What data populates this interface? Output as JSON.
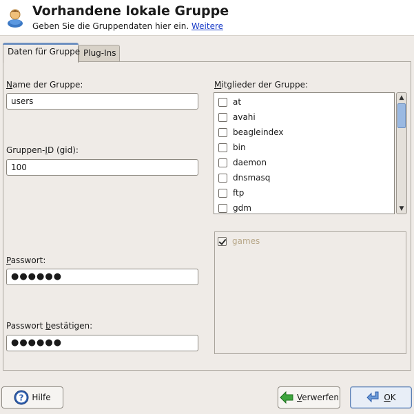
{
  "header": {
    "title": "Vorhandene lokale Gruppe",
    "subtitle": "Geben Sie die Gruppendaten hier ein.",
    "more_link": "Weitere",
    "icon": "group-user-icon"
  },
  "tabs": [
    {
      "label": "Daten für Gruppe",
      "active": true
    },
    {
      "label": "Plug-Ins",
      "active": false
    }
  ],
  "form": {
    "group_name": {
      "label_mn": "N",
      "label_rest": "ame der Gruppe:",
      "value": "users"
    },
    "group_id": {
      "label_pre": "Gruppen-",
      "label_mn": "I",
      "label_rest": "D (gid):",
      "value": "100"
    },
    "password": {
      "label_mn": "P",
      "label_rest": "asswort:",
      "value": "●●●●●●"
    },
    "password_confirm": {
      "label_pre": "Passwort ",
      "label_mn": "b",
      "label_rest": "estätigen:",
      "value": "●●●●●●"
    }
  },
  "members": {
    "label_mn": "M",
    "label_rest": "itglieder der Gruppe:",
    "items": [
      {
        "name": "at",
        "checked": false
      },
      {
        "name": "avahi",
        "checked": false
      },
      {
        "name": "beagleindex",
        "checked": false
      },
      {
        "name": "bin",
        "checked": false
      },
      {
        "name": "daemon",
        "checked": false
      },
      {
        "name": "dnsmasq",
        "checked": false
      },
      {
        "name": "ftp",
        "checked": false
      },
      {
        "name": "gdm",
        "checked": false
      }
    ]
  },
  "default_members": {
    "items": [
      {
        "name": "games",
        "checked": true
      }
    ]
  },
  "buttons": {
    "help": "Hilfe",
    "discard_mn": "V",
    "discard_rest": "erwerfen",
    "ok_mn": "O",
    "ok_rest": "K"
  },
  "colors": {
    "link": "#1a3cc8",
    "disabled_text": "#b8a88a",
    "accent": "#6c8fc0"
  }
}
